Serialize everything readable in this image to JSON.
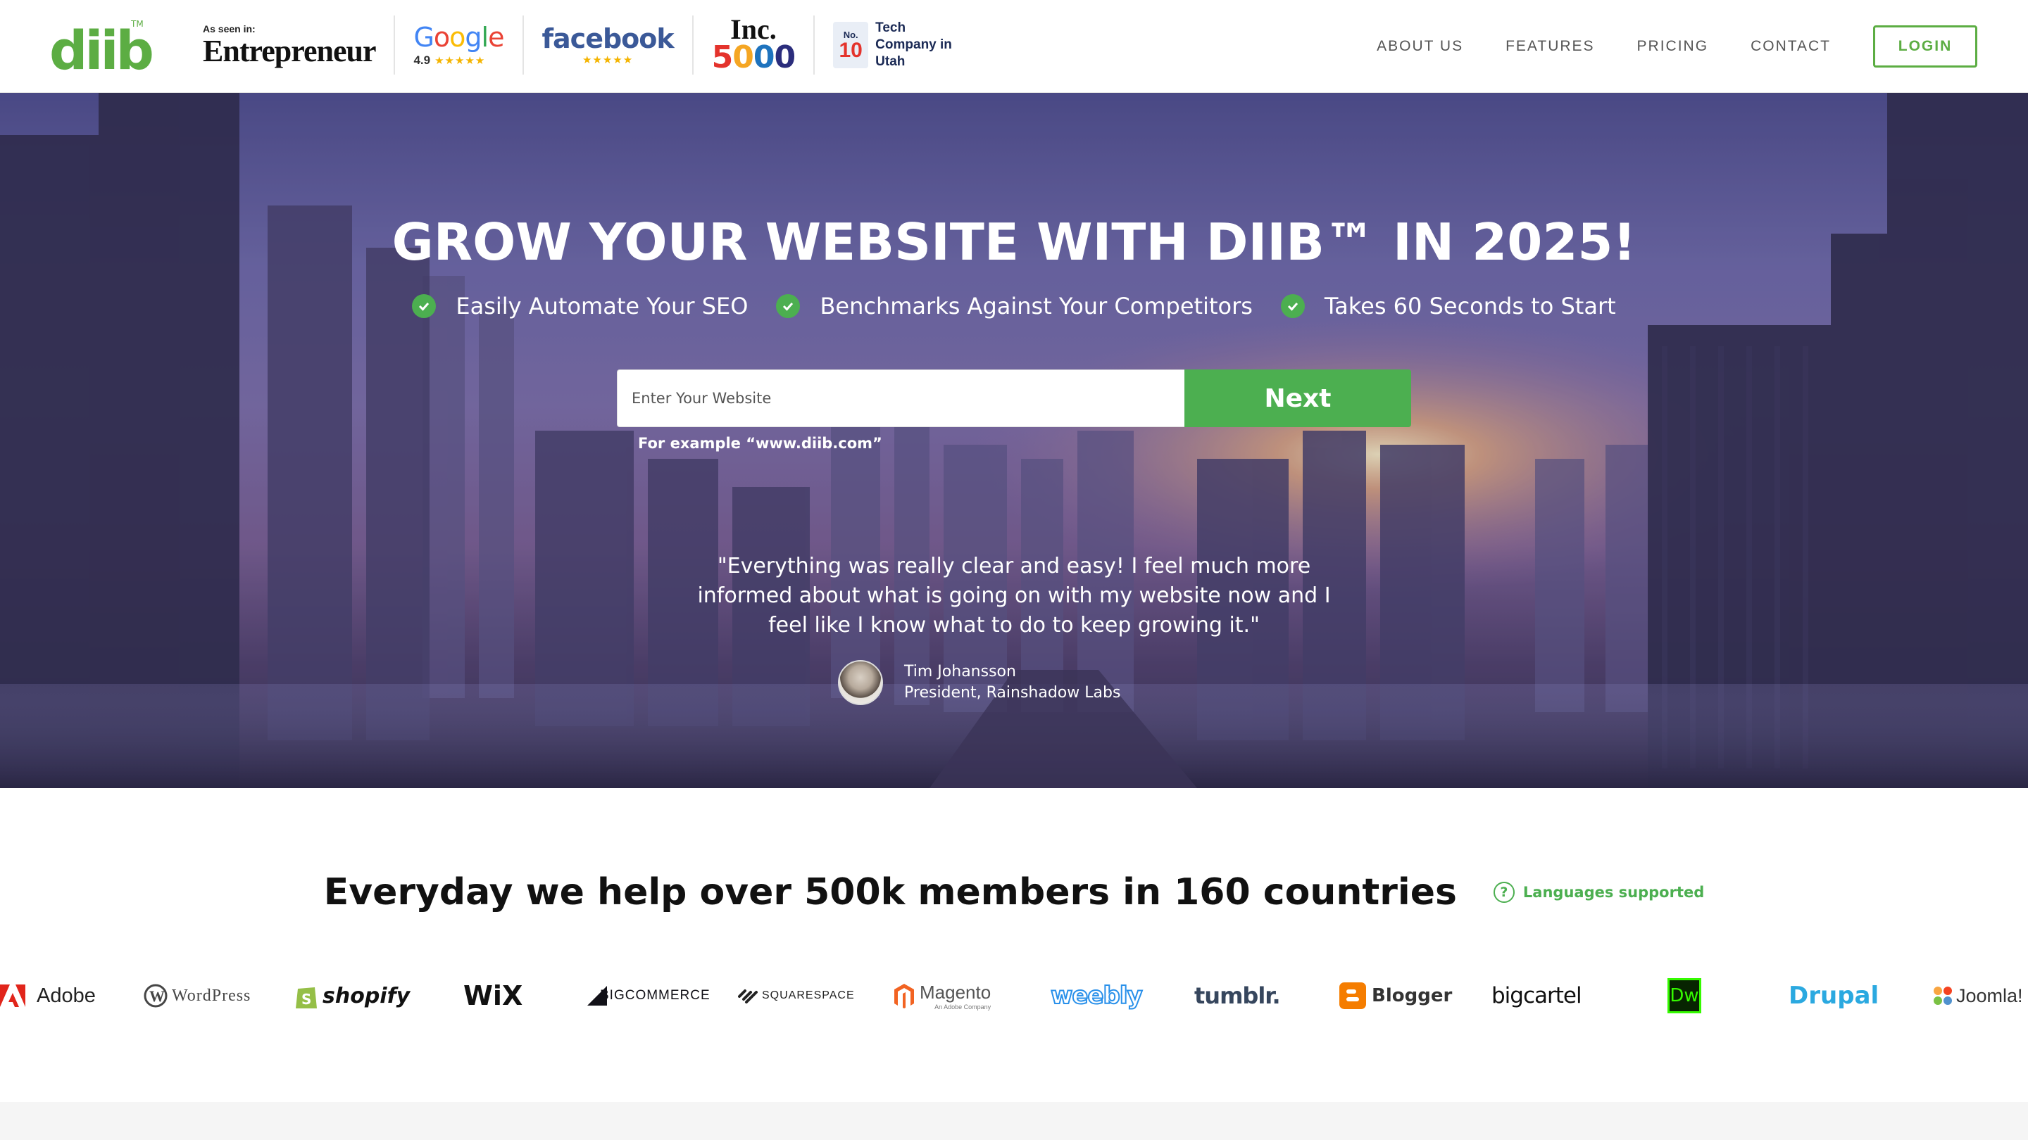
{
  "header": {
    "logo_text": "diib",
    "logo_tm": "TM",
    "seen_in": "As seen in:",
    "entrepreneur": "Entrepreneur",
    "google": {
      "word": "Google",
      "rating": "4.9",
      "stars": "★★★★★"
    },
    "facebook": {
      "word": "facebook",
      "stars": "★★★★★"
    },
    "inc": {
      "top": "Inc.",
      "number": "5000"
    },
    "no10": {
      "no": "No.",
      "num": "10",
      "text": "Tech Company in Utah"
    },
    "nav": [
      "ABOUT US",
      "FEATURES",
      "PRICING",
      "CONTACT"
    ],
    "login": "LOGIN"
  },
  "hero": {
    "title": "GROW YOUR WEBSITE WITH DIIB™ IN 2025!",
    "features": [
      "Easily Automate Your SEO",
      "Benchmarks Against Your Competitors",
      "Takes 60 Seconds to Start"
    ],
    "input_placeholder": "Enter Your Website",
    "next_label": "Next",
    "example": "For example “www.diib.com”",
    "quote": "\"Everything was really clear and easy! I feel much more informed about what is going on with my website now and I feel like I know what to do to keep growing it.\"",
    "author_name": "Tim Johansson",
    "author_title": "President, Rainshadow Labs"
  },
  "members": {
    "title": "Everyday we help over 500k members in 160 countries",
    "languages": "Languages supported",
    "platforms": [
      "Adobe",
      "WordPress",
      "shopify",
      "WiX",
      "BIGCOMMERCE",
      "SQUARESPACE",
      "Magento",
      "weebly",
      "tumblr.",
      "Blogger",
      "bigcartel",
      "Dw",
      "Drupal",
      "Joomla!"
    ],
    "magento_sub": "An Adobe Company"
  },
  "colors": {
    "brand_green": "#5cad43",
    "button_green": "#4caf50",
    "nav_text": "#555555"
  }
}
